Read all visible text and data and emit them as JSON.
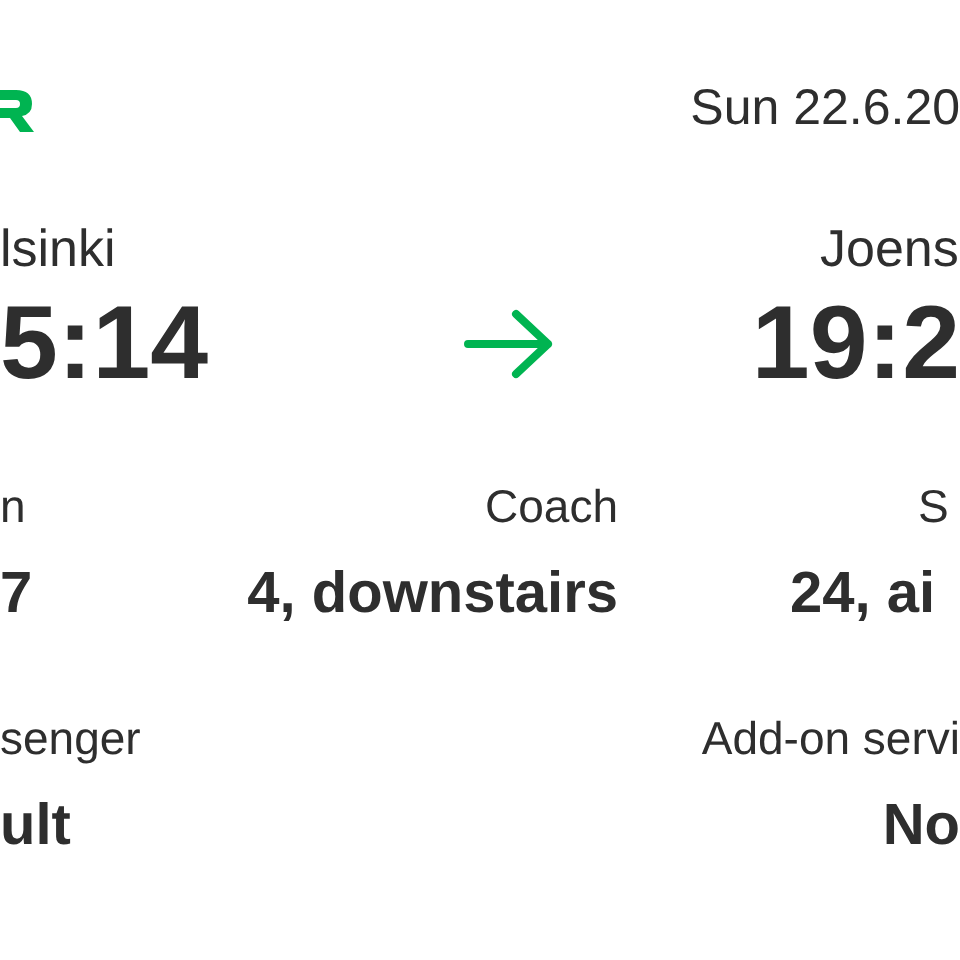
{
  "header": {
    "date": "Sun 22.6.20"
  },
  "journey": {
    "departure": {
      "station": "lsinki",
      "time": "5:14"
    },
    "arrival": {
      "station": "Joens",
      "time": "19:2"
    }
  },
  "details_row_1": [
    {
      "label": "n",
      "value": "7"
    },
    {
      "label": "Coach",
      "value": "4, downstairs"
    },
    {
      "label": "S",
      "value": "24, ai"
    }
  ],
  "details_row_2": [
    {
      "label": "senger",
      "value": "ult"
    },
    {
      "label": "Add-on servi",
      "value": "No"
    }
  ]
}
